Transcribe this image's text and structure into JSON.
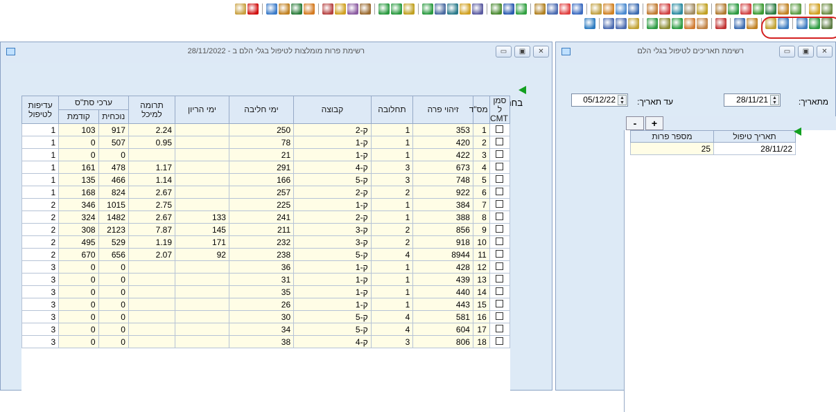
{
  "toolbar": {
    "row1": [
      "#c8a040",
      "#d01010",
      "#3a7ac8",
      "#c08020",
      "#2a7c3a",
      "#d47a20",
      "#b54040",
      "#d0a020",
      "#8a5aa0",
      "#9a6a30",
      "#2a9a40",
      "#2a9a40",
      "#c0a020",
      "#2a9a40",
      "#4a6aa0",
      "#2a7a8a",
      "#d0a020",
      "#5a5aa0",
      "#4a8a30",
      "#2a5ab0",
      "#30a040",
      "#b08020",
      "#4a6ab0",
      "#e04040",
      "#3a6ac0",
      "#c0a040",
      "#d08020",
      "#4a8ad0",
      "#3a6ab0",
      "#c07a30",
      "#d04040",
      "#2a8aa0",
      "#a08a60",
      "#c0a020",
      "#b07a30",
      "#2a9a40",
      "#d04040",
      "#3a9a30",
      "#2a7a40",
      "#c08020",
      "#5a9a40",
      "#d0a020",
      "#6a8a40"
    ],
    "row2": [
      "#2a7ac0",
      "#4a6ab0",
      "#4a6ab0",
      "#c0a030",
      "#2a9a40",
      "#8a8a30",
      "#2a9a40",
      "#d07a30",
      "#c08040",
      "#c03030",
      "#3a6ab0",
      "#c08020",
      "#c0a030",
      "#3a7ac0",
      "#3a7ac0",
      "#2a9a40",
      "#5a7a40"
    ]
  },
  "left_window": {
    "title": "רשימת פרות מומלצות לטיפול בגלי הלם ב - 28/11/2022",
    "select_all_label": "בחר הכל",
    "headers": {
      "cmt": "סמן ל CMT",
      "row_no": "מס\"ד",
      "cow_id": "זיהוי פרה",
      "calving": "תחלובה",
      "group": "קבוצה",
      "milk_days": "ימי חליבה",
      "preg_days": "ימי הריון",
      "contrib": "תרומה למיכל",
      "scc_group": "ערכי סת\"ס",
      "scc_current": "נוכחית",
      "scc_prev": "קודמת",
      "priority": "עדיפות לטיפול"
    },
    "rows": [
      {
        "no": "1",
        "cow": "353",
        "calv": "1",
        "grp": "ק-2",
        "milk": "250",
        "preg": "",
        "contrib": "2.24",
        "cur": "917",
        "prev": "103",
        "pri": "1"
      },
      {
        "no": "2",
        "cow": "420",
        "calv": "1",
        "grp": "ק-1",
        "milk": "78",
        "preg": "",
        "contrib": "0.95",
        "cur": "507",
        "prev": "0",
        "pri": "1"
      },
      {
        "no": "3",
        "cow": "422",
        "calv": "1",
        "grp": "ק-1",
        "milk": "21",
        "preg": "",
        "contrib": "",
        "cur": "0",
        "prev": "0",
        "pri": "1"
      },
      {
        "no": "4",
        "cow": "673",
        "calv": "3",
        "grp": "ק-4",
        "milk": "291",
        "preg": "",
        "contrib": "1.17",
        "cur": "478",
        "prev": "161",
        "pri": "1"
      },
      {
        "no": "5",
        "cow": "748",
        "calv": "3",
        "grp": "ק-5",
        "milk": "166",
        "preg": "",
        "contrib": "1.14",
        "cur": "466",
        "prev": "135",
        "pri": "1"
      },
      {
        "no": "6",
        "cow": "922",
        "calv": "2",
        "grp": "ק-2",
        "milk": "257",
        "preg": "",
        "contrib": "2.67",
        "cur": "824",
        "prev": "168",
        "pri": "1"
      },
      {
        "no": "7",
        "cow": "384",
        "calv": "1",
        "grp": "ק-1",
        "milk": "225",
        "preg": "",
        "contrib": "2.75",
        "cur": "1015",
        "prev": "346",
        "pri": "2"
      },
      {
        "no": "8",
        "cow": "388",
        "calv": "1",
        "grp": "ק-2",
        "milk": "241",
        "preg": "133",
        "contrib": "2.67",
        "cur": "1482",
        "prev": "324",
        "pri": "2"
      },
      {
        "no": "9",
        "cow": "856",
        "calv": "2",
        "grp": "ק-3",
        "milk": "211",
        "preg": "145",
        "contrib": "7.87",
        "cur": "2123",
        "prev": "308",
        "pri": "2"
      },
      {
        "no": "10",
        "cow": "918",
        "calv": "2",
        "grp": "ק-3",
        "milk": "232",
        "preg": "171",
        "contrib": "1.19",
        "cur": "529",
        "prev": "495",
        "pri": "2"
      },
      {
        "no": "11",
        "cow": "8944",
        "calv": "4",
        "grp": "ק-5",
        "milk": "238",
        "preg": "92",
        "contrib": "2.07",
        "cur": "656",
        "prev": "670",
        "pri": "2"
      },
      {
        "no": "12",
        "cow": "428",
        "calv": "1",
        "grp": "ק-1",
        "milk": "36",
        "preg": "",
        "contrib": "",
        "cur": "0",
        "prev": "0",
        "pri": "3"
      },
      {
        "no": "13",
        "cow": "439",
        "calv": "1",
        "grp": "ק-1",
        "milk": "31",
        "preg": "",
        "contrib": "",
        "cur": "0",
        "prev": "0",
        "pri": "3"
      },
      {
        "no": "14",
        "cow": "440",
        "calv": "1",
        "grp": "ק-1",
        "milk": "35",
        "preg": "",
        "contrib": "",
        "cur": "0",
        "prev": "0",
        "pri": "3"
      },
      {
        "no": "15",
        "cow": "443",
        "calv": "1",
        "grp": "ק-1",
        "milk": "26",
        "preg": "",
        "contrib": "",
        "cur": "0",
        "prev": "0",
        "pri": "3"
      },
      {
        "no": "16",
        "cow": "581",
        "calv": "4",
        "grp": "ק-5",
        "milk": "30",
        "preg": "",
        "contrib": "",
        "cur": "0",
        "prev": "0",
        "pri": "3"
      },
      {
        "no": "17",
        "cow": "604",
        "calv": "4",
        "grp": "ק-5",
        "milk": "34",
        "preg": "",
        "contrib": "",
        "cur": "0",
        "prev": "0",
        "pri": "3"
      },
      {
        "no": "18",
        "cow": "806",
        "calv": "3",
        "grp": "ק-4",
        "milk": "38",
        "preg": "",
        "contrib": "",
        "cur": "0",
        "prev": "0",
        "pri": "3"
      }
    ]
  },
  "right_window": {
    "title": "רשימת תאריכים לטיפול בגלי הלם",
    "from_label": "מתאריך:",
    "from_value": "28/11/21",
    "to_label": "עד תאריך:",
    "to_value": "05/12/22",
    "plus": "+",
    "minus": "-",
    "headers": {
      "date": "תאריך טיפול",
      "count": "מספר פרות"
    },
    "rows": [
      {
        "date": "28/11/22",
        "count": "25"
      }
    ]
  },
  "win_buttons": {
    "close": "✕",
    "maximize": "▣",
    "minimize": "▭"
  }
}
